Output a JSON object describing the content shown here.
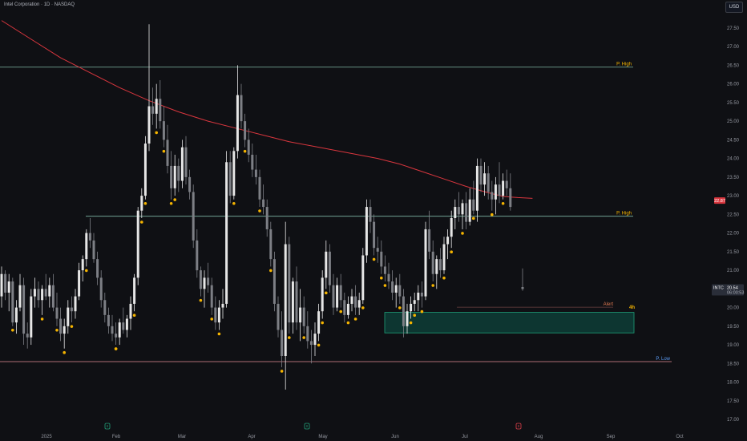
{
  "header": {
    "title": "Intel Corporation · 1D · NASDAQ",
    "currency": "USD"
  },
  "colors": {
    "bg": "#0f1014",
    "up": "#e6e6e6",
    "down": "#7d7f85",
    "ma": "#d9363e",
    "high_line": "#7fb8a8",
    "low_line": "#e58c96",
    "marker": "#f5b400",
    "zone_fill": "#0d3b34",
    "zone_stroke": "#1fa07a",
    "last_price": "#2a2e39"
  },
  "chart_data": {
    "type": "candlestick",
    "symbol": "INTC",
    "ylim": [
      16.85,
      27.95
    ],
    "yticks": [
      "27.50",
      "27.00",
      "26.50",
      "26.00",
      "25.50",
      "25.00",
      "24.50",
      "24.00",
      "23.50",
      "23.00",
      "22.50",
      "22.00",
      "21.50",
      "21.00",
      "20.50",
      "20.00",
      "19.50",
      "19.00",
      "18.50",
      "18.00",
      "17.50",
      "17.00"
    ],
    "xticks": [
      "2025",
      "Feb",
      "Mar",
      "Apr",
      "May",
      "Jun",
      "Jul",
      "Aug",
      "Sep",
      "Oct"
    ],
    "candles": [
      [
        20.3,
        21.1,
        20.0,
        20.9
      ],
      [
        20.9,
        21.0,
        20.2,
        20.4
      ],
      [
        20.4,
        20.9,
        19.9,
        20.7
      ],
      [
        20.7,
        20.8,
        19.5,
        19.6
      ],
      [
        19.6,
        20.2,
        19.3,
        20.0
      ],
      [
        20.0,
        20.9,
        19.9,
        20.6
      ],
      [
        20.6,
        20.8,
        19.0,
        19.3
      ],
      [
        19.3,
        19.6,
        18.9,
        19.2
      ],
      [
        19.2,
        20.5,
        19.0,
        20.3
      ],
      [
        20.3,
        20.8,
        20.0,
        20.5
      ],
      [
        20.5,
        20.7,
        20.0,
        20.2
      ],
      [
        20.2,
        20.6,
        19.8,
        20.5
      ],
      [
        20.5,
        20.9,
        20.2,
        20.3
      ],
      [
        20.3,
        20.8,
        20.0,
        20.6
      ],
      [
        20.6,
        20.9,
        19.9,
        20.0
      ],
      [
        20.0,
        20.4,
        19.5,
        19.7
      ],
      [
        19.7,
        20.0,
        19.1,
        19.3
      ],
      [
        19.3,
        19.7,
        18.9,
        19.5
      ],
      [
        19.5,
        20.2,
        19.3,
        20.0
      ],
      [
        20.0,
        20.3,
        19.6,
        19.9
      ],
      [
        19.9,
        20.5,
        19.7,
        20.3
      ],
      [
        20.3,
        21.2,
        20.2,
        21.0
      ],
      [
        21.0,
        21.4,
        20.7,
        21.3
      ],
      [
        21.3,
        22.1,
        21.1,
        22.0
      ],
      [
        22.0,
        22.4,
        21.6,
        21.8
      ],
      [
        21.8,
        22.0,
        21.2,
        21.3
      ],
      [
        21.3,
        21.5,
        20.6,
        20.8
      ],
      [
        20.8,
        21.0,
        20.0,
        20.2
      ],
      [
        20.2,
        20.4,
        19.6,
        19.8
      ],
      [
        19.8,
        20.0,
        19.3,
        19.5
      ],
      [
        19.5,
        19.8,
        19.1,
        19.3
      ],
      [
        19.3,
        19.6,
        19.0,
        19.2
      ],
      [
        19.2,
        19.7,
        19.0,
        19.6
      ],
      [
        19.6,
        20.0,
        19.3,
        19.4
      ],
      [
        19.4,
        19.8,
        19.2,
        19.7
      ],
      [
        19.7,
        20.3,
        19.4,
        20.1
      ],
      [
        20.1,
        20.9,
        19.9,
        20.8
      ],
      [
        20.8,
        22.7,
        20.6,
        22.6
      ],
      [
        22.6,
        23.2,
        22.4,
        23.0
      ],
      [
        23.0,
        24.6,
        22.9,
        24.4
      ],
      [
        24.4,
        27.6,
        24.2,
        25.4
      ],
      [
        25.4,
        25.9,
        24.9,
        25.2
      ],
      [
        25.2,
        26.0,
        24.8,
        25.6
      ],
      [
        25.6,
        26.1,
        24.8,
        25.0
      ],
      [
        25.0,
        25.4,
        24.3,
        24.5
      ],
      [
        24.5,
        24.9,
        23.6,
        23.8
      ],
      [
        23.8,
        24.2,
        22.9,
        23.2
      ],
      [
        23.2,
        24.1,
        23.0,
        23.8
      ],
      [
        23.8,
        24.0,
        23.1,
        23.4
      ],
      [
        23.4,
        24.5,
        23.2,
        24.3
      ],
      [
        24.3,
        24.6,
        23.3,
        23.5
      ],
      [
        23.5,
        23.7,
        22.9,
        23.1
      ],
      [
        23.1,
        23.3,
        21.6,
        21.8
      ],
      [
        21.8,
        22.1,
        20.8,
        21.0
      ],
      [
        21.0,
        21.1,
        20.3,
        20.5
      ],
      [
        20.5,
        21.0,
        20.0,
        20.8
      ],
      [
        20.8,
        21.2,
        20.4,
        20.6
      ],
      [
        20.6,
        20.8,
        19.8,
        20.0
      ],
      [
        20.0,
        20.3,
        19.4,
        19.6
      ],
      [
        19.6,
        20.2,
        19.4,
        20.0
      ],
      [
        20.0,
        20.5,
        19.7,
        20.1
      ],
      [
        20.1,
        24.2,
        20.0,
        23.9
      ],
      [
        23.9,
        24.2,
        22.8,
        23.0
      ],
      [
        23.0,
        24.3,
        22.9,
        24.2
      ],
      [
        24.2,
        26.5,
        24.0,
        25.7
      ],
      [
        25.7,
        26.0,
        24.8,
        25.0
      ],
      [
        25.0,
        25.2,
        24.3,
        24.5
      ],
      [
        24.5,
        24.8,
        23.9,
        24.1
      ],
      [
        24.1,
        24.4,
        23.5,
        23.7
      ],
      [
        23.7,
        24.1,
        23.3,
        23.5
      ],
      [
        23.5,
        23.7,
        22.7,
        22.9
      ],
      [
        22.9,
        23.3,
        22.5,
        22.7
      ],
      [
        22.7,
        22.9,
        21.9,
        22.1
      ],
      [
        22.1,
        22.3,
        21.1,
        21.3
      ],
      [
        21.3,
        21.5,
        19.9,
        20.1
      ],
      [
        20.1,
        20.3,
        19.2,
        19.4
      ],
      [
        19.4,
        19.9,
        18.4,
        18.7
      ],
      [
        18.7,
        22.3,
        17.8,
        21.7
      ],
      [
        21.7,
        21.9,
        19.3,
        19.6
      ],
      [
        19.6,
        20.8,
        19.3,
        20.7
      ],
      [
        20.7,
        21.1,
        19.4,
        19.6
      ],
      [
        19.6,
        20.5,
        19.1,
        20.0
      ],
      [
        20.0,
        20.3,
        19.3,
        19.5
      ],
      [
        19.5,
        19.9,
        18.9,
        19.1
      ],
      [
        19.1,
        19.4,
        18.5,
        19.0
      ],
      [
        19.0,
        19.6,
        18.7,
        19.3
      ],
      [
        19.3,
        20.1,
        19.1,
        19.9
      ],
      [
        19.9,
        21.0,
        19.7,
        20.8
      ],
      [
        20.8,
        21.8,
        20.5,
        21.5
      ],
      [
        21.5,
        21.7,
        20.4,
        20.6
      ],
      [
        20.6,
        20.9,
        19.8,
        20.0
      ],
      [
        20.0,
        20.8,
        19.9,
        20.6
      ],
      [
        20.6,
        20.9,
        20.0,
        20.2
      ],
      [
        20.2,
        20.4,
        19.6,
        19.8
      ],
      [
        19.8,
        20.3,
        19.7,
        20.1
      ],
      [
        20.1,
        20.5,
        19.9,
        20.3
      ],
      [
        20.3,
        20.6,
        19.8,
        20.0
      ],
      [
        20.0,
        20.4,
        19.8,
        20.2
      ],
      [
        20.2,
        21.6,
        20.1,
        21.4
      ],
      [
        21.4,
        22.9,
        21.2,
        22.7
      ],
      [
        22.7,
        22.9,
        22.0,
        22.3
      ],
      [
        22.3,
        22.5,
        21.4,
        21.6
      ],
      [
        21.6,
        21.9,
        21.2,
        21.5
      ],
      [
        21.5,
        21.8,
        20.9,
        21.1
      ],
      [
        21.1,
        21.4,
        20.7,
        20.9
      ],
      [
        20.9,
        21.2,
        20.5,
        20.7
      ],
      [
        20.7,
        21.0,
        20.2,
        20.4
      ],
      [
        20.4,
        20.8,
        20.0,
        20.6
      ],
      [
        20.6,
        20.9,
        20.1,
        20.3
      ],
      [
        20.3,
        20.5,
        19.2,
        19.5
      ],
      [
        19.5,
        20.1,
        19.3,
        19.9
      ],
      [
        19.9,
        20.3,
        19.7,
        20.1
      ],
      [
        20.1,
        20.4,
        19.9,
        20.2
      ],
      [
        20.2,
        20.6,
        19.9,
        20.4
      ],
      [
        20.4,
        20.7,
        20.0,
        20.3
      ],
      [
        20.3,
        22.3,
        20.2,
        22.1
      ],
      [
        22.1,
        22.6,
        21.3,
        21.5
      ],
      [
        21.5,
        21.8,
        20.7,
        20.9
      ],
      [
        20.9,
        21.4,
        20.5,
        21.3
      ],
      [
        21.3,
        21.6,
        20.8,
        21.0
      ],
      [
        21.0,
        21.9,
        20.9,
        21.7
      ],
      [
        21.7,
        22.1,
        21.3,
        21.9
      ],
      [
        21.9,
        22.6,
        21.6,
        22.4
      ],
      [
        22.4,
        22.9,
        22.1,
        22.7
      ],
      [
        22.7,
        23.1,
        22.3,
        22.5
      ],
      [
        22.5,
        22.9,
        22.1,
        22.8
      ],
      [
        22.8,
        23.1,
        22.1,
        22.3
      ],
      [
        22.3,
        23.2,
        22.2,
        22.9
      ],
      [
        22.9,
        23.4,
        22.5,
        22.6
      ],
      [
        22.6,
        24.0,
        22.3,
        23.8
      ],
      [
        23.8,
        24.0,
        23.1,
        23.3
      ],
      [
        23.3,
        23.9,
        23.0,
        23.6
      ],
      [
        23.6,
        23.8,
        22.9,
        23.1
      ],
      [
        23.1,
        23.4,
        22.6,
        22.9
      ],
      [
        22.9,
        23.5,
        22.5,
        23.3
      ],
      [
        23.3,
        23.9,
        22.8,
        23.0
      ],
      [
        23.0,
        23.6,
        22.9,
        23.4
      ],
      [
        23.4,
        23.7,
        23.0,
        23.2
      ],
      [
        23.2,
        23.6,
        22.6,
        22.7
      ]
    ],
    "last_candle": [
      20.55,
      21.05,
      20.45,
      20.54
    ],
    "ma_points": [
      [
        0,
        27.7
      ],
      [
        8,
        27.2
      ],
      [
        16,
        26.7
      ],
      [
        24,
        26.3
      ],
      [
        32,
        25.9
      ],
      [
        40,
        25.55
      ],
      [
        48,
        25.25
      ],
      [
        56,
        25.0
      ],
      [
        64,
        24.8
      ],
      [
        72,
        24.6
      ],
      [
        78,
        24.45
      ],
      [
        86,
        24.3
      ],
      [
        94,
        24.15
      ],
      [
        102,
        24.0
      ],
      [
        108,
        23.85
      ],
      [
        114,
        23.65
      ],
      [
        120,
        23.45
      ],
      [
        126,
        23.25
      ],
      [
        132,
        23.08
      ],
      [
        136,
        22.98
      ],
      [
        140,
        22.95
      ],
      [
        144,
        22.93
      ]
    ],
    "levels": [
      {
        "value": 26.45,
        "label": "P. High",
        "kind": "high",
        "x0": 0,
        "x1": 790
      },
      {
        "value": 22.45,
        "label": "P. High",
        "kind": "high",
        "x0": 107,
        "x1": 790
      },
      {
        "value": 18.55,
        "label": "P. Low",
        "kind": "low",
        "x0": 0,
        "x1": 838
      }
    ],
    "zone": {
      "top": 19.87,
      "bottom": 19.32,
      "x0": 480,
      "x1": 791
    },
    "alert": {
      "value": 20.01,
      "label": "Alert",
      "tag": "4h"
    },
    "last_price": {
      "value": 20.54,
      "symbol": "INTC",
      "text": "20.54",
      "countdown": "06:00:53"
    },
    "ma_label": "22.87",
    "markers_below": [
      3,
      11,
      15,
      17,
      19,
      23,
      31,
      36,
      38,
      44,
      47,
      59,
      63,
      66,
      76,
      78,
      86,
      87,
      88,
      103,
      104,
      112,
      114,
      120,
      122,
      125,
      128,
      133,
      136
    ],
    "markers_above": [
      31,
      39,
      42,
      46,
      54,
      57,
      70,
      73,
      82,
      92,
      94,
      96,
      98,
      101,
      108,
      111,
      117
    ],
    "event_icons": [
      {
        "x": 134,
        "kind": "earnings"
      },
      {
        "x": 383,
        "kind": "earnings"
      },
      {
        "x": 647,
        "kind": "dividend"
      }
    ]
  }
}
